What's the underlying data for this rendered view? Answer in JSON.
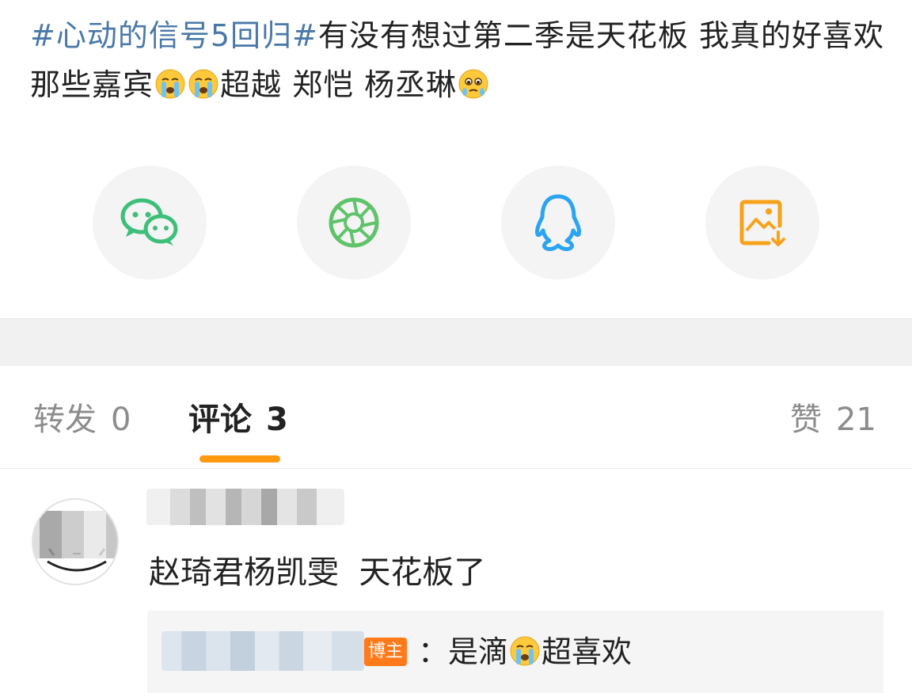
{
  "post": {
    "hashtag": "#心动的信号5回归#",
    "text_before_emoji": "有没有想过第二季是天花板 我真的好喜欢那些嘉宾",
    "text_after_emoji": "超越 郑恺 杨丞琳",
    "emojis": [
      "crying-emoji",
      "crying-emoji",
      "tearful-emoji"
    ],
    "hashtag_color": "#4a78a8"
  },
  "share": {
    "items": [
      {
        "icon": "wechat-icon",
        "color": "#3dbf7a"
      },
      {
        "icon": "moments-icon",
        "color": "#5fc36a"
      },
      {
        "icon": "qq-icon",
        "color": "#2ba4f2"
      },
      {
        "icon": "save-image-icon",
        "color": "#f7a21b"
      }
    ]
  },
  "tabs": {
    "repost": {
      "label": "转发",
      "count": "0"
    },
    "comments": {
      "label": "评论",
      "count": "3"
    },
    "likes": {
      "label": "赞",
      "count": "21"
    },
    "accent": "#ff9a0e"
  },
  "comment": {
    "text": "赵琦君杨凯雯  天花板了",
    "reply": {
      "badge": "博主",
      "text_prefix": "：是滴",
      "text_suffix": "超喜欢",
      "emoji": "crying-emoji"
    }
  }
}
